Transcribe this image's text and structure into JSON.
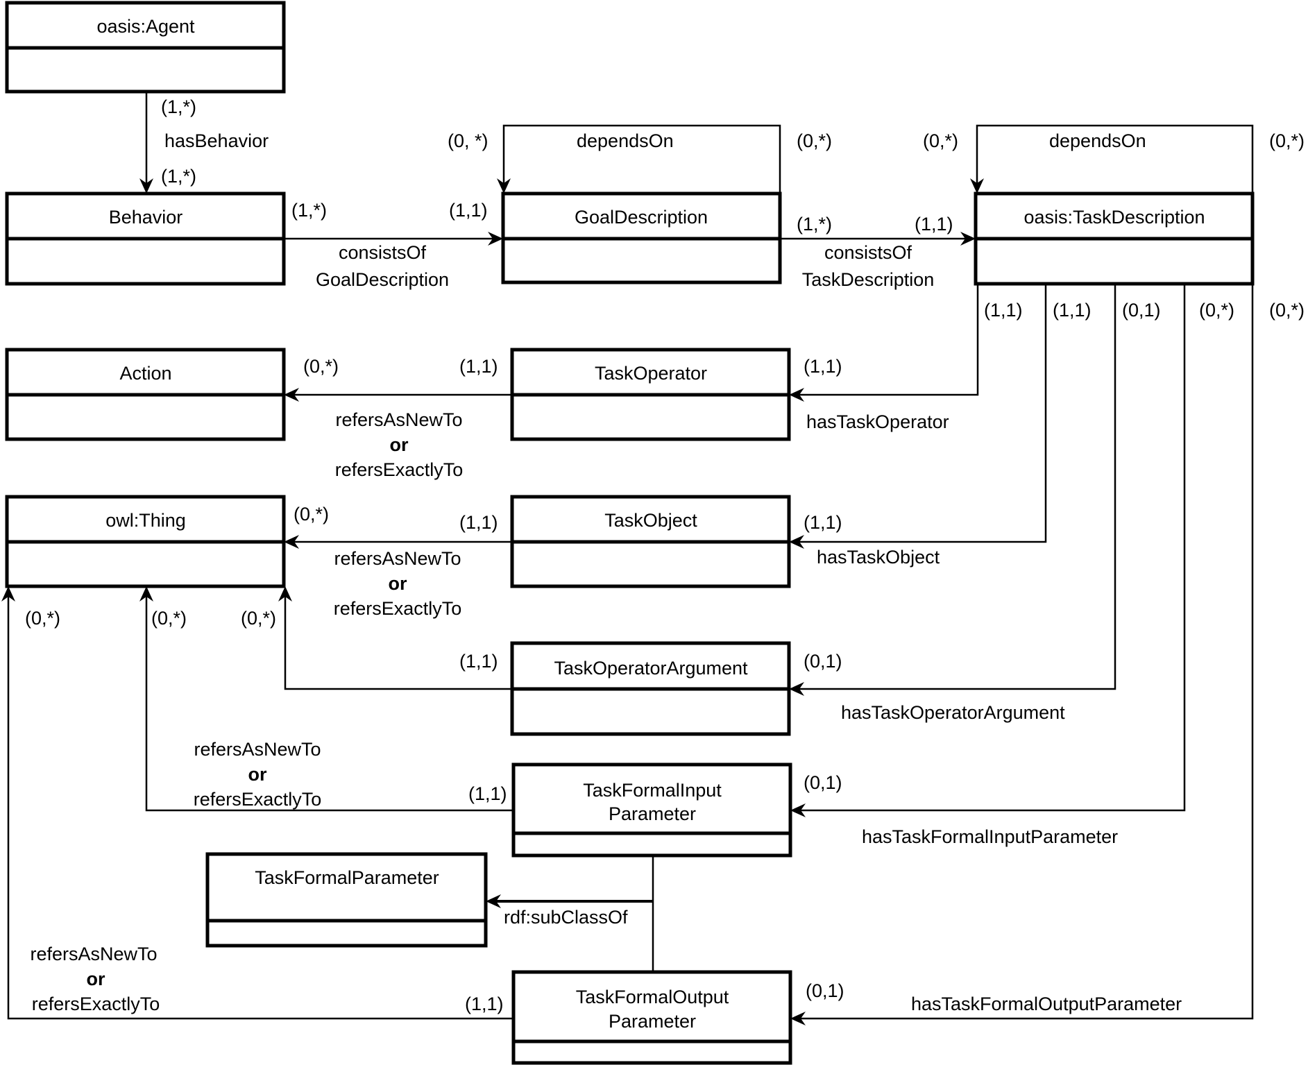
{
  "classes": {
    "agent": "oasis:Agent",
    "behavior": "Behavior",
    "goal_description": "GoalDescription",
    "task_description": "oasis:TaskDescription",
    "action": "Action",
    "task_operator": "TaskOperator",
    "owl_thing": "owl:Thing",
    "task_object": "TaskObject",
    "task_operator_argument": "TaskOperatorArgument",
    "task_formal_input_parameter": [
      "TaskFormalInput",
      "Parameter"
    ],
    "task_formal_parameter": "TaskFormalParameter",
    "task_formal_output_parameter": [
      "TaskFormalOutput",
      "Parameter"
    ]
  },
  "relations": {
    "has_behavior": {
      "label": "hasBehavior",
      "source_card": "(1,*)",
      "target_card": "(1,*)"
    },
    "consists_of_goal": {
      "label": [
        "consistsOf",
        "GoalDescription"
      ],
      "source_card": "(1,*)",
      "target_card": "(1,1)"
    },
    "goal_depends_on": {
      "label": "dependsOn",
      "source_card": "(0,*)",
      "target_card": "(0, *)"
    },
    "consists_of_task": {
      "label": [
        "consistsOf",
        "TaskDescription"
      ],
      "source_card": "(1,*)",
      "target_card": "(1,1)"
    },
    "task_depends_on": {
      "label": "dependsOn",
      "source_card": "(0,*)",
      "target_card": "(0,*)"
    },
    "has_task_operator": {
      "label": "hasTaskOperator",
      "source_card": "(1,1)",
      "target_card": "(1,1)"
    },
    "has_task_object": {
      "label": "hasTaskObject",
      "source_card": "(1,1)",
      "target_card": "(1,1)"
    },
    "has_task_operator_argument": {
      "label": "hasTaskOperatorArgument",
      "source_card": "(0,1)",
      "target_card": "(0,1)"
    },
    "has_task_formal_input_parameter": {
      "label": "hasTaskFormalInputParameter",
      "source_card": "(0,*)",
      "target_card": "(0,1)"
    },
    "has_task_formal_output_parameter": {
      "label": "hasTaskFormalOutputParameter",
      "source_card": "(0,*)",
      "target_card": "(0,1)"
    },
    "operator_refers": {
      "label": [
        "refersAsNewTo",
        "or",
        "refersExactlyTo"
      ],
      "source_card": "(1,1)",
      "target_card": "(0,*)"
    },
    "object_refers": {
      "label": [
        "refersAsNewTo",
        "or",
        "refersExactlyTo"
      ],
      "source_card": "(1,1)",
      "target_card": "(0,*)"
    },
    "argument_refers": {
      "label": [
        "refersAsNewTo",
        "or",
        "refersExactlyTo"
      ],
      "source_card": "(1,1)",
      "target_card": "(0,*)"
    },
    "input_refers": {
      "label": [
        "refersAsNewTo",
        "or",
        "refersExactlyTo"
      ],
      "source_card": "(1,1)",
      "target_card": "(0,*)"
    },
    "output_refers": {
      "label": [
        "refersAsNewTo",
        "or",
        "refersExactlyTo"
      ],
      "source_card": "(1,1)",
      "target_card": "(0,*)"
    },
    "subclass_of": {
      "label": "rdf:subClassOf"
    }
  }
}
